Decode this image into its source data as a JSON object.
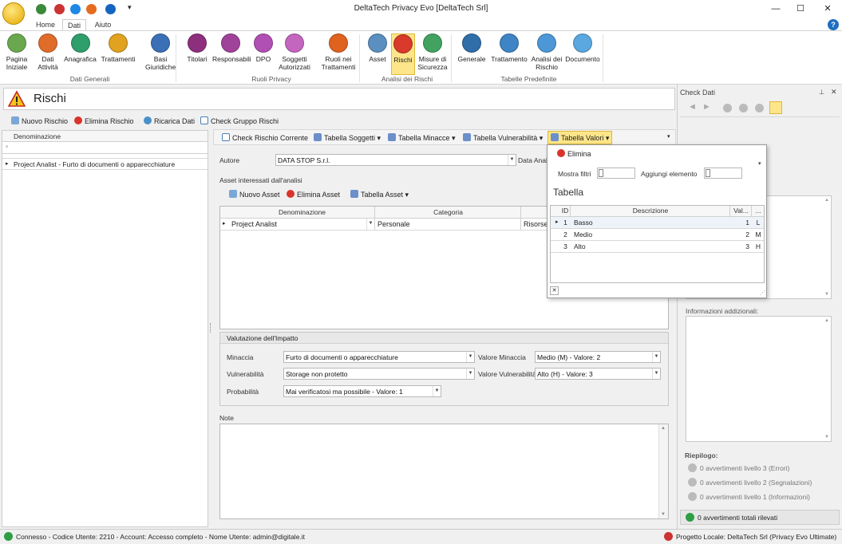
{
  "window": {
    "title": "DeltaTech Privacy Evo [DeltaTech Srl]"
  },
  "ribbon_tabs": [
    "Home",
    "Dati",
    "Aiuto"
  ],
  "ribbon": {
    "groups": [
      {
        "label": "Dati Generali",
        "buttons": [
          {
            "label": "Pagina\nIniziale",
            "color": "#6aa84f"
          },
          {
            "label": "Dati\nAttività",
            "color": "#e06c2a"
          },
          {
            "label": "Anagrafica",
            "color": "#2e9e6a"
          },
          {
            "label": "Trattamenti",
            "color": "#e0a21f"
          },
          {
            "label": "Basi\nGiuridiche",
            "color": "#3b6fb6"
          }
        ]
      },
      {
        "label": "Ruoli Privacy",
        "buttons": [
          {
            "label": "Titolari",
            "color": "#8e2f7d"
          },
          {
            "label": "Responsabili",
            "color": "#a0429a"
          },
          {
            "label": "DPO",
            "color": "#b04fb4"
          },
          {
            "label": "Soggetti\nAutorizzati",
            "color": "#c465c0"
          },
          {
            "label": "Ruoli nei\nTrattamenti",
            "color": "#e0621f"
          }
        ]
      },
      {
        "label": "Analisi dei Rischi",
        "buttons": [
          {
            "label": "Asset",
            "color": "#5a8fbf"
          },
          {
            "label": "Rischi",
            "color": "#d93a2b"
          },
          {
            "label": "Misure di\nSicurezza",
            "color": "#41a35f"
          }
        ]
      },
      {
        "label": "Tabelle Predefinite",
        "buttons": [
          {
            "label": "Generale",
            "color": "#2f6ea8"
          },
          {
            "label": "Trattamento",
            "color": "#3f84c4"
          },
          {
            "label": "Analisi dei\nRischio",
            "color": "#4d97d6"
          },
          {
            "label": "Documento",
            "color": "#5ba7e0"
          }
        ]
      }
    ]
  },
  "panel": {
    "title": "Rischi"
  },
  "main_toolbar": [
    "Nuovo Rischio",
    "Elimina Rischio",
    "Ricarica Dati",
    "Check Gruppo Rischi"
  ],
  "list": {
    "header": "Denominazione",
    "rows": [
      "Project Analist  - Furto di documenti o apparecchiature"
    ]
  },
  "detail_toolbar": [
    "Check Rischio Corrente",
    "Tabella Soggetti",
    "Tabella Minacce",
    "Tabella Vulnerabilità",
    "Tabella Valori"
  ],
  "form": {
    "autore_label": "Autore",
    "autore_value": "DATA STOP S.r.l.",
    "data_label": "Data Anal",
    "asset_section": "Asset interessati dall'analisi",
    "asset_toolbar": [
      "Nuovo Asset",
      "Elimina Asset",
      "Tabella Asset"
    ],
    "asset_headers": [
      "Denominazione",
      "Categoria"
    ],
    "asset_row": [
      "Project Analist",
      "Personale",
      "Risorse I"
    ],
    "valutazione_title": "Valutazione dell'Impatto",
    "minaccia_label": "Minaccia",
    "minaccia_value": "Furto di documenti o apparecchiature",
    "vulnerabilita_label": "Vulnerabilità",
    "vulnerabilita_value": "Storage non protetto",
    "probabilita_label": "Probabilità",
    "probabilita_value": "Mai verificatosi ma possibile - Valore: 1",
    "valore_minaccia_label": "Valore Minaccia",
    "valore_minaccia_value": "Medio (M) - Valore: 2",
    "valore_vuln_label": "Valore Vulnerabilità",
    "valore_vuln_value": "Alto (H) - Valore: 3",
    "note_label": "Note"
  },
  "popup": {
    "elimina": "Elimina",
    "mostra_filtri": "Mostra filtri",
    "aggiungi": "Aggiungi elemento",
    "title": "Tabella",
    "headers": [
      "ID",
      "Descrizione",
      "Val...",
      "..."
    ],
    "rows": [
      {
        "id": "1",
        "desc": "Basso",
        "val": "1",
        "code": "L"
      },
      {
        "id": "2",
        "desc": "Medio",
        "val": "2",
        "code": "M"
      },
      {
        "id": "3",
        "desc": "Alto",
        "val": "3",
        "code": "H"
      }
    ]
  },
  "check_panel": {
    "title": "Check Dati",
    "info_label": "Informazioni addizionali:",
    "riepilogo": "Riepilogo:",
    "lines": [
      "0 avvertimenti livello 3 (Errori)",
      "0 avvertimenti livello 2 (Segnalazioni)",
      "0 avvertimenti livello 1 (Informazioni)"
    ],
    "total": "0 avvertimenti totali rilevati"
  },
  "status": {
    "left": "Connesso - Codice Utente: 2210 - Account: Accesso completo - Nome Utente: admin@digitale.it",
    "right": "Progetto Locale: DeltaTech Srl (Privacy Evo Ultimate)"
  }
}
